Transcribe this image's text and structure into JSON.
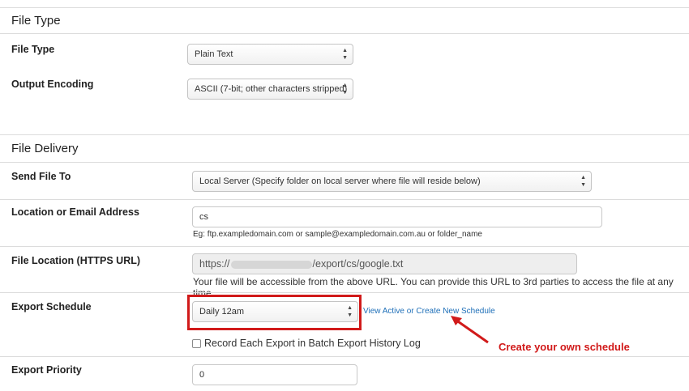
{
  "colors": {
    "accent_red": "#d11a1a",
    "link_blue": "#1e6fb8",
    "divider": "#dcdcdc"
  },
  "file_type_section": {
    "title": "File Type",
    "file_type": {
      "label": "File Type",
      "value": "Plain Text"
    },
    "output_encoding": {
      "label": "Output Encoding",
      "value": "ASCII (7-bit; other characters stripped)"
    }
  },
  "file_delivery_section": {
    "title": "File Delivery",
    "send_file_to": {
      "label": "Send File To",
      "value": "Local Server (Specify folder on local server where file will reside below)"
    },
    "location": {
      "label": "Location or Email Address",
      "value": "cs",
      "help": "Eg: ftp.exampledomain.com or sample@exampledomain.com.au or folder_name"
    },
    "file_location": {
      "label": "File Location (HTTPS URL)",
      "url_prefix": "https://",
      "url_suffix": "/export/cs/google.txt",
      "info": "Your file will be accessible from the above URL. You can provide this URL to 3rd parties to access the file at any time."
    },
    "export_schedule": {
      "label": "Export Schedule",
      "value": "Daily 12am",
      "link": "View Active or Create New Schedule",
      "annotation": "Create your own schedule"
    },
    "record_export": {
      "label": "Record Each Export in Batch Export History Log",
      "checked": false
    },
    "export_priority": {
      "label": "Export Priority",
      "value": "0"
    }
  },
  "icons": {
    "select_arrow": "chevron-up-down-icon",
    "annotation_arrow": "arrow-icon"
  }
}
